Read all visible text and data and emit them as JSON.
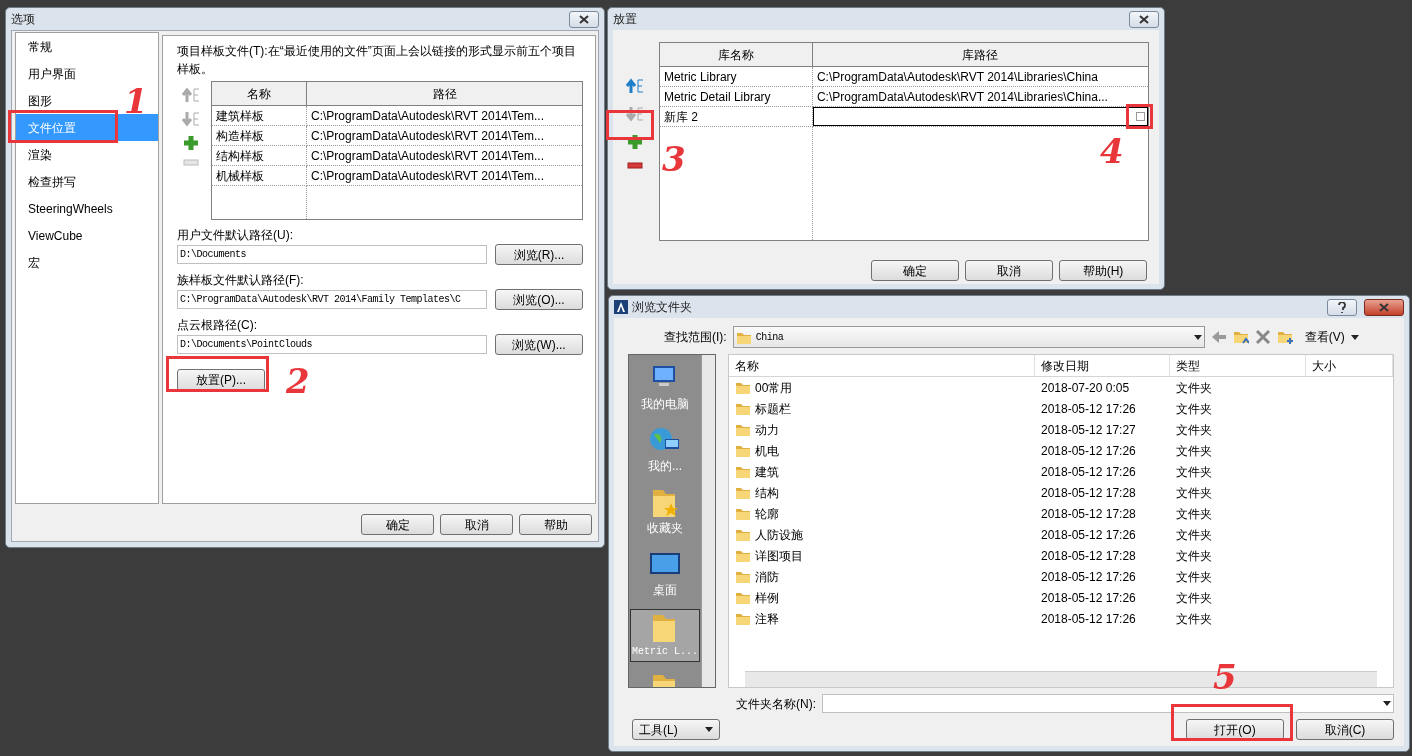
{
  "options_dialog": {
    "title": "选项",
    "nav": [
      {
        "label": "常规",
        "selected": false
      },
      {
        "label": "用户界面",
        "selected": false
      },
      {
        "label": "图形",
        "selected": false
      },
      {
        "label": "文件位置",
        "selected": true
      },
      {
        "label": "渲染",
        "selected": false
      },
      {
        "label": "检查拼写",
        "selected": false
      },
      {
        "label": "SteeringWheels",
        "selected": false
      },
      {
        "label": "ViewCube",
        "selected": false
      },
      {
        "label": "宏",
        "selected": false
      }
    ],
    "template_intro": "项目样板文件(T):在“最近使用的文件”页面上会以链接的形式显示前五个项目样板。",
    "tools": [
      {
        "kind": "up",
        "disabled": true
      },
      {
        "kind": "down",
        "disabled": true
      },
      {
        "kind": "add",
        "disabled": false
      },
      {
        "kind": "remove",
        "disabled": true
      }
    ],
    "columns": [
      "名称",
      "路径"
    ],
    "rows": [
      {
        "name": "建筑样板",
        "path": "C:\\ProgramData\\Autodesk\\RVT 2014\\Tem..."
      },
      {
        "name": "构造样板",
        "path": "C:\\ProgramData\\Autodesk\\RVT 2014\\Tem..."
      },
      {
        "name": "结构样板",
        "path": "C:\\ProgramData\\Autodesk\\RVT 2014\\Tem..."
      },
      {
        "name": "机械样板",
        "path": "C:\\ProgramData\\Autodesk\\RVT 2014\\Tem..."
      }
    ],
    "paths": [
      {
        "label": "用户文件默认路径(U):",
        "value": "D:\\Documents",
        "button": "浏览(R)..."
      },
      {
        "label": "族样板文件默认路径(F):",
        "value": "C:\\ProgramData\\Autodesk\\RVT 2014\\Family Templates\\C",
        "button": "浏览(O)..."
      },
      {
        "label": "点云根路径(C):",
        "value": "D:\\Documents\\PointClouds",
        "button": "浏览(W)..."
      }
    ],
    "places_button": "放置(P)...",
    "buttons": [
      "确定",
      "取消",
      "帮助"
    ]
  },
  "places_dialog": {
    "title": "放置",
    "tools": [
      {
        "kind": "up",
        "disabled": false
      },
      {
        "kind": "down",
        "disabled": true
      },
      {
        "kind": "add",
        "disabled": false
      },
      {
        "kind": "remove",
        "disabled": false
      }
    ],
    "columns": [
      "库名称",
      "库路径"
    ],
    "rows": [
      {
        "name": "Metric Library",
        "path": "C:\\ProgramData\\Autodesk\\RVT 2014\\Libraries\\China",
        "editing": false
      },
      {
        "name": "Metric Detail Library",
        "path": "C:\\ProgramData\\Autodesk\\RVT 2014\\Libraries\\China...",
        "editing": false
      },
      {
        "name": "新库 2",
        "editing": true
      }
    ],
    "buttons": [
      "确定",
      "取消",
      "帮助(H)"
    ]
  },
  "browse_dialog": {
    "title": "浏览文件夹",
    "look_in_label": "查找范围(I):",
    "look_in": "China",
    "view_label": "查看(V)",
    "places": [
      {
        "kind": "computer",
        "label": "我的电脑",
        "selected": false
      },
      {
        "kind": "network",
        "label": "我的...",
        "selected": false
      },
      {
        "kind": "favorites",
        "label": "收藏夹",
        "selected": false
      },
      {
        "kind": "desktop",
        "label": "桌面",
        "selected": false
      },
      {
        "kind": "folder",
        "label": "Metric L...",
        "selected": true
      },
      {
        "kind": "folder",
        "selected": false
      }
    ],
    "columns": [
      "名称",
      "修改日期",
      "类型",
      "大小"
    ],
    "rows": [
      {
        "name": "00常用",
        "modified": "2018-07-20 0:05",
        "type": "文件夹"
      },
      {
        "name": "标题栏",
        "modified": "2018-05-12 17:26",
        "type": "文件夹"
      },
      {
        "name": "动力",
        "modified": "2018-05-12 17:27",
        "type": "文件夹"
      },
      {
        "name": "机电",
        "modified": "2018-05-12 17:26",
        "type": "文件夹"
      },
      {
        "name": "建筑",
        "modified": "2018-05-12 17:26",
        "type": "文件夹"
      },
      {
        "name": "结构",
        "modified": "2018-05-12 17:28",
        "type": "文件夹"
      },
      {
        "name": "轮廓",
        "modified": "2018-05-12 17:28",
        "type": "文件夹"
      },
      {
        "name": "人防设施",
        "modified": "2018-05-12 17:26",
        "type": "文件夹"
      },
      {
        "name": "详图项目",
        "modified": "2018-05-12 17:28",
        "type": "文件夹"
      },
      {
        "name": "消防",
        "modified": "2018-05-12 17:26",
        "type": "文件夹"
      },
      {
        "name": "样例",
        "modified": "2018-05-12 17:26",
        "type": "文件夹"
      },
      {
        "name": "注释",
        "modified": "2018-05-12 17:26",
        "type": "文件夹"
      }
    ],
    "folder_name_label": "文件夹名称(N):",
    "tools_button": "工具(L)",
    "open_button": "打开(O)",
    "cancel_button": "取消(C)"
  },
  "annotations": [
    {
      "label": "1"
    },
    {
      "label": "2"
    },
    {
      "label": "3"
    },
    {
      "label": "4"
    },
    {
      "label": "5"
    }
  ]
}
